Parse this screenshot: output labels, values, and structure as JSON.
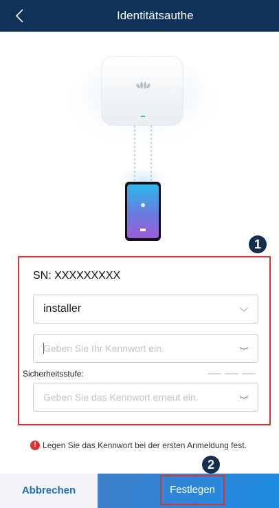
{
  "header": {
    "title": "Identitätsauthe"
  },
  "annotations": {
    "badge1": "1",
    "badge2": "2"
  },
  "form": {
    "sn_label": "SN: XXXXXXXXX",
    "username_value": "installer",
    "password_placeholder": "Geben Sie Ihr Kennwort ein.",
    "strength_label": "Sicherheitsstufe:",
    "confirm_placeholder": "Geben Sie das Kennwort erneut ein."
  },
  "notice": {
    "icon": "!",
    "text": "Legen Sie das Kennwort bei der ersten Anmeldung fest."
  },
  "footer": {
    "cancel_label": "Abbrechen",
    "confirm_label": "Festlegen"
  },
  "icons": {
    "back": "chevron-left-icon",
    "dropdown": "chevron-down-icon",
    "eye": "eye-closed-icon",
    "info": "exclamation-icon"
  },
  "colors": {
    "header_bg": "#0f3358",
    "accent_red": "#e02f2f",
    "primary_blue": "#1e8ce2",
    "cancel_text": "#1d6fc1"
  }
}
